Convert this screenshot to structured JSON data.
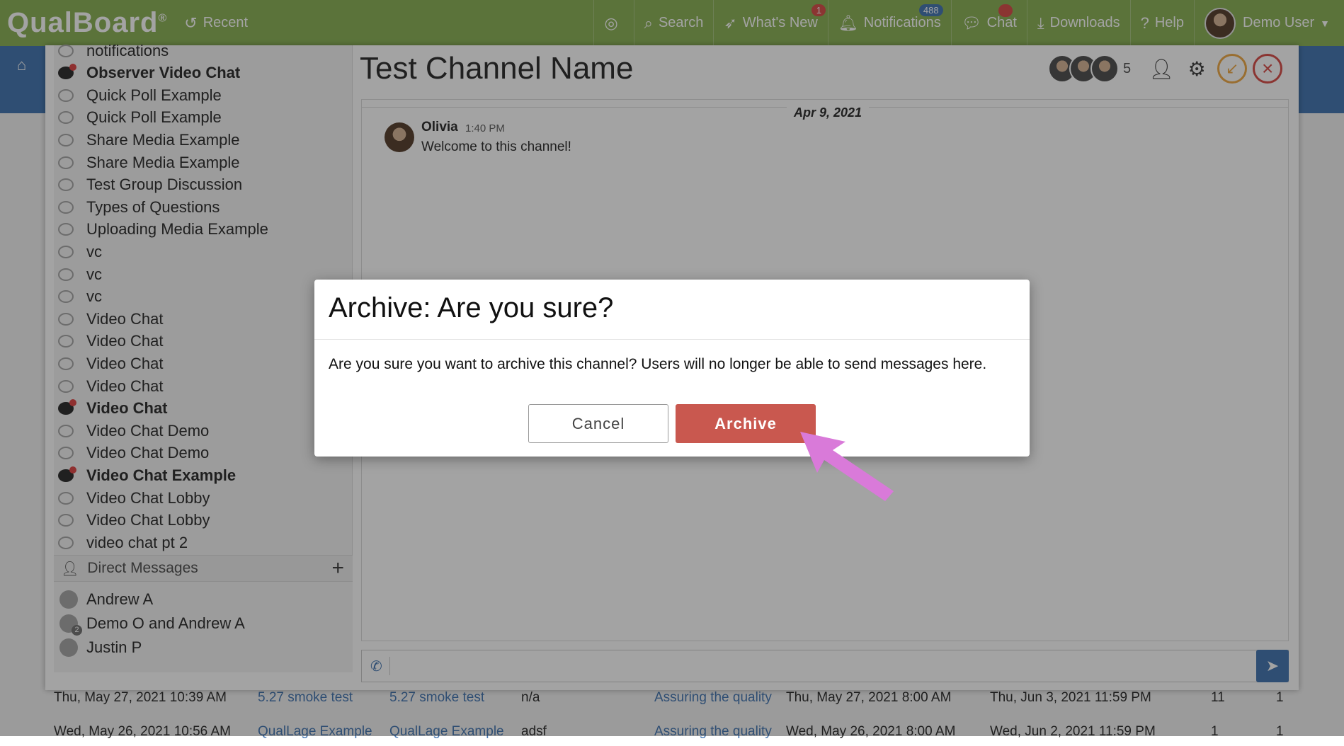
{
  "topbar": {
    "logo": "QualBoard",
    "logo_mark": "®",
    "recent": "Recent",
    "search": "Search",
    "whats_new": "What's New",
    "whats_new_badge": "1",
    "notifications": "Notifications",
    "notifications_badge": "488",
    "chat": "Chat",
    "downloads": "Downloads",
    "help": "Help",
    "user": "Demo User"
  },
  "background": {
    "rows": [
      {
        "date": "Thu, May 27, 2021 10:39 AM",
        "link1": "5.27 smoke test",
        "link2": "5.27 smoke test",
        "value": "n/a",
        "link3": "Assuring the quality",
        "start": "Thu, May 27, 2021 8:00 AM",
        "end": "Thu, Jun 3, 2021 11:59 PM",
        "n1": "11",
        "n2": "1"
      },
      {
        "date": "Wed, May 26, 2021 10:56 AM",
        "link1": "QualLage Example",
        "link2": "QualLage Example",
        "value": "adsf",
        "link3": "Assuring the quality",
        "start": "Wed, May 26, 2021 8:00 AM",
        "end": "Wed, Jun 2, 2021 11:59 PM",
        "n1": "1",
        "n2": "1"
      }
    ]
  },
  "sidebar": {
    "channels": [
      {
        "label": "notifications",
        "unread": false
      },
      {
        "label": "Observer Video Chat",
        "unread": true
      },
      {
        "label": "Quick Poll Example",
        "unread": false
      },
      {
        "label": "Quick Poll Example",
        "unread": false
      },
      {
        "label": "Share Media Example",
        "unread": false
      },
      {
        "label": "Share Media Example",
        "unread": false
      },
      {
        "label": "Test Group Discussion",
        "unread": false
      },
      {
        "label": "Types of Questions",
        "unread": false
      },
      {
        "label": "Uploading Media Example",
        "unread": false
      },
      {
        "label": "vc",
        "unread": false
      },
      {
        "label": "vc",
        "unread": false
      },
      {
        "label": "vc",
        "unread": false
      },
      {
        "label": "Video Chat",
        "unread": false
      },
      {
        "label": "Video Chat",
        "unread": false
      },
      {
        "label": "Video Chat",
        "unread": false
      },
      {
        "label": "Video Chat",
        "unread": false
      },
      {
        "label": "Video Chat",
        "unread": true
      },
      {
        "label": "Video Chat Demo",
        "unread": false
      },
      {
        "label": "Video Chat Demo",
        "unread": false
      },
      {
        "label": "Video Chat Example",
        "unread": true
      },
      {
        "label": "Video Chat Lobby",
        "unread": false
      },
      {
        "label": "Video Chat Lobby",
        "unread": false
      },
      {
        "label": "video chat pt 2",
        "unread": false
      }
    ],
    "dm_header": "Direct Messages",
    "direct_messages": [
      {
        "label": "Andrew A"
      },
      {
        "label": "Demo O and Andrew A",
        "badge": "2"
      },
      {
        "label": "Justin P"
      }
    ]
  },
  "channel": {
    "title": "Test Channel Name",
    "member_count": "5",
    "date": "Apr 9, 2021",
    "message": {
      "author": "Olivia",
      "time": "1:40 PM",
      "text": "Welcome to this channel!"
    }
  },
  "dialog": {
    "title": "Archive: Are you sure?",
    "body": "Are you sure you want to archive this channel? Users will no longer be able to send messages here.",
    "cancel": "Cancel",
    "archive": "Archive"
  },
  "colors": {
    "topbar": "#8fb55c",
    "primary": "#4a7bb5",
    "danger": "#c9584f",
    "pointer": "#d97ad9"
  }
}
